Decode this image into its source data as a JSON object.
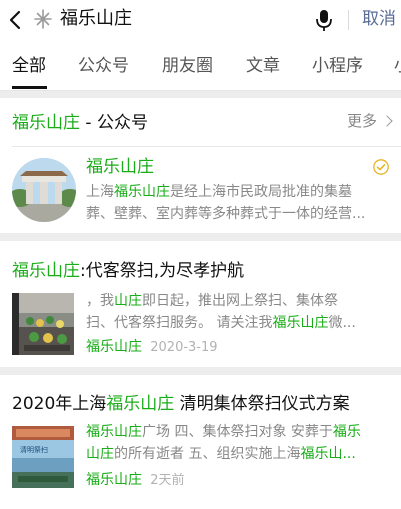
{
  "search": {
    "query": "福乐山庄",
    "cancel_label": "取消"
  },
  "tabs": [
    "全部",
    "公众号",
    "朋友圈",
    "文章",
    "小程序",
    "小"
  ],
  "account_section": {
    "title_highlight": "福乐山庄",
    "title_suffix": " - 公众号",
    "more_label": "更多",
    "account": {
      "name": "福乐山庄",
      "desc_line1_pre": "上海",
      "desc_line1_hl": "福乐山庄",
      "desc_line1_post": "是经上海市民政局批准的集墓",
      "desc_line2": "葬、壁葬、室内葬等多种葬式于一体的经营..."
    }
  },
  "articles": [
    {
      "title_hl": "福乐山庄",
      "title_rest": ":代客祭扫,为尽孝护航",
      "line1_pre": "，我",
      "line1_hl": "山庄",
      "line1_post": "即日起，推出网上祭扫、集体祭",
      "line2_pre": "扫、代客祭扫服务。 请关注我",
      "line2_hl": "福乐山庄",
      "line2_post": "微...",
      "source": "福乐山庄",
      "date": "2020-3-19"
    },
    {
      "title_pre": "2020年上海",
      "title_hl": "福乐山庄",
      "title_rest": " 清明集体祭扫仪式方案",
      "line1_hl": "福乐山庄",
      "line1_mid": "广场 四、集体祭扫对象 安葬于",
      "line1_hl2": "福乐",
      "line2_hl": "山庄",
      "line2_mid": "的所有逝者 五、组织实施上海",
      "line2_hl2": "福乐山...",
      "source": "福乐山庄",
      "date": "2天前"
    }
  ],
  "colors": {
    "highlight": "#1aad19",
    "link": "#576b95",
    "background": "#ededed"
  }
}
